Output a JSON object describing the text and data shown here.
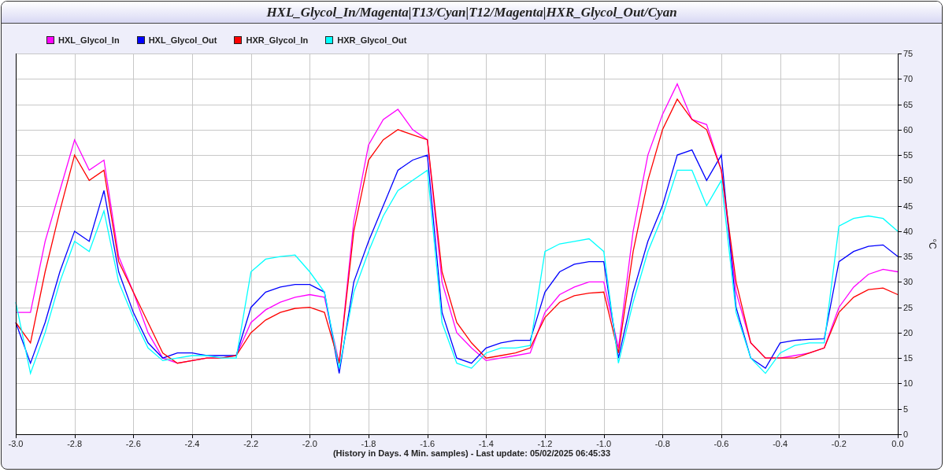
{
  "window": {
    "title": "HXL_Glycol_In/Magenta|T13/Cyan|T12/Magenta|HXR_Glycol_Out/Cyan"
  },
  "chart": {
    "chart_data": {
      "type": "line",
      "xlabel": "(History in Days. 4 Min. samples) - Last update: 05/02/2025 06:45:33",
      "ylabel": "°C",
      "x": [
        -3.0,
        -2.95,
        -2.9,
        -2.85,
        -2.8,
        -2.75,
        -2.7,
        -2.65,
        -2.6,
        -2.55,
        -2.5,
        -2.45,
        -2.4,
        -2.35,
        -2.3,
        -2.25,
        -2.2,
        -2.15,
        -2.1,
        -2.05,
        -2.0,
        -1.95,
        -1.9,
        -1.85,
        -1.8,
        -1.75,
        -1.7,
        -1.65,
        -1.6,
        -1.55,
        -1.5,
        -1.45,
        -1.4,
        -1.35,
        -1.3,
        -1.25,
        -1.2,
        -1.15,
        -1.1,
        -1.05,
        -1.0,
        -0.95,
        -0.9,
        -0.85,
        -0.8,
        -0.75,
        -0.7,
        -0.65,
        -0.6,
        -0.55,
        -0.5,
        -0.45,
        -0.4,
        -0.35,
        -0.3,
        -0.25,
        -0.2,
        -0.15,
        -0.1,
        -0.05,
        0.0
      ],
      "series": [
        {
          "name": "HXL_Glycol_In",
          "color": "#ff00ff",
          "values": [
            24,
            24,
            38,
            48,
            58,
            52,
            54,
            35,
            28,
            20,
            15,
            14,
            14.5,
            15,
            15,
            15.5,
            22,
            24.5,
            26,
            27,
            27.5,
            27,
            14,
            42,
            57,
            62,
            64,
            60,
            58,
            30,
            20,
            17,
            14.5,
            15,
            15.5,
            16,
            24,
            27.5,
            29,
            30,
            30,
            17,
            40,
            55,
            63,
            69,
            62,
            61,
            52,
            28,
            18,
            15,
            15,
            15.5,
            16,
            17,
            25,
            29,
            31.5,
            32.5,
            32
          ]
        },
        {
          "name": "HXL_Glycol_Out",
          "color": "#0000ff",
          "values": [
            22,
            14,
            22,
            32,
            40,
            38,
            48,
            32,
            24,
            18,
            15,
            16,
            16,
            15.5,
            15.5,
            15.5,
            25,
            28,
            29,
            29.5,
            29.5,
            28,
            12,
            30,
            38,
            45,
            52,
            54,
            55,
            24,
            15,
            14,
            17,
            18,
            18.5,
            18.5,
            28,
            32,
            33.5,
            34,
            34,
            15,
            28,
            38,
            45,
            55,
            56,
            50,
            55,
            25,
            15,
            13,
            18,
            18.5,
            18.7,
            18.8,
            34,
            36,
            37,
            37.3,
            35
          ]
        },
        {
          "name": "HXR_Glycol_In",
          "color": "#ff0000",
          "values": [
            22,
            18,
            32,
            44,
            55,
            50,
            52,
            34,
            28,
            22,
            16,
            14,
            14.5,
            15,
            15,
            15.5,
            20,
            22.5,
            24,
            24.8,
            25,
            24,
            14,
            40,
            54,
            58,
            60,
            59,
            58,
            32,
            22,
            18,
            15,
            15.5,
            16,
            17,
            23,
            26,
            27.3,
            27.8,
            28,
            16,
            36,
            50,
            60,
            66,
            62,
            60,
            52,
            30,
            18,
            15,
            15,
            15,
            16,
            17,
            24,
            27,
            28.5,
            28.8,
            27.5
          ]
        },
        {
          "name": "HXR_Glycol_Out",
          "color": "#00ffff",
          "values": [
            26,
            12,
            20,
            30,
            38,
            36,
            44,
            30,
            23,
            17,
            14.5,
            15,
            15.5,
            15.5,
            15,
            15,
            32,
            34.5,
            35,
            35.3,
            32,
            28,
            13,
            28,
            36,
            43,
            48,
            50,
            52,
            22,
            14,
            13,
            16,
            17,
            17,
            17.5,
            36,
            37.5,
            38,
            38.5,
            36,
            14,
            26,
            36,
            43,
            52,
            52,
            45,
            50,
            24,
            15,
            12,
            16,
            17.5,
            18,
            18,
            41,
            42.5,
            43,
            42.5,
            40
          ]
        }
      ],
      "xlim": [
        -3,
        0
      ],
      "ylim": [
        0,
        75
      ],
      "grid": true,
      "xticks": [
        {
          "value": -3,
          "label": "-3.0"
        },
        {
          "value": -2.8,
          "label": "-2.8"
        },
        {
          "value": -2.6,
          "label": "-2.6"
        },
        {
          "value": -2.4,
          "label": "-2.4"
        },
        {
          "value": -2.2,
          "label": "-2.2"
        },
        {
          "value": -2,
          "label": "-2.0"
        },
        {
          "value": -1.8,
          "label": "-1.8"
        },
        {
          "value": -1.6,
          "label": "-1.6"
        },
        {
          "value": -1.4,
          "label": "-1.4"
        },
        {
          "value": -1.2,
          "label": "-1.2"
        },
        {
          "value": -1,
          "label": "-1.0"
        },
        {
          "value": -0.8,
          "label": "-0.8"
        },
        {
          "value": -0.6,
          "label": "-0.6"
        },
        {
          "value": -0.4,
          "label": "-0.4"
        },
        {
          "value": -0.2,
          "label": "-0.2"
        },
        {
          "value": 0,
          "label": "0.0"
        }
      ],
      "yticks": [
        0,
        5,
        10,
        15,
        20,
        25,
        30,
        35,
        40,
        45,
        50,
        55,
        60,
        65,
        70,
        75
      ]
    }
  }
}
